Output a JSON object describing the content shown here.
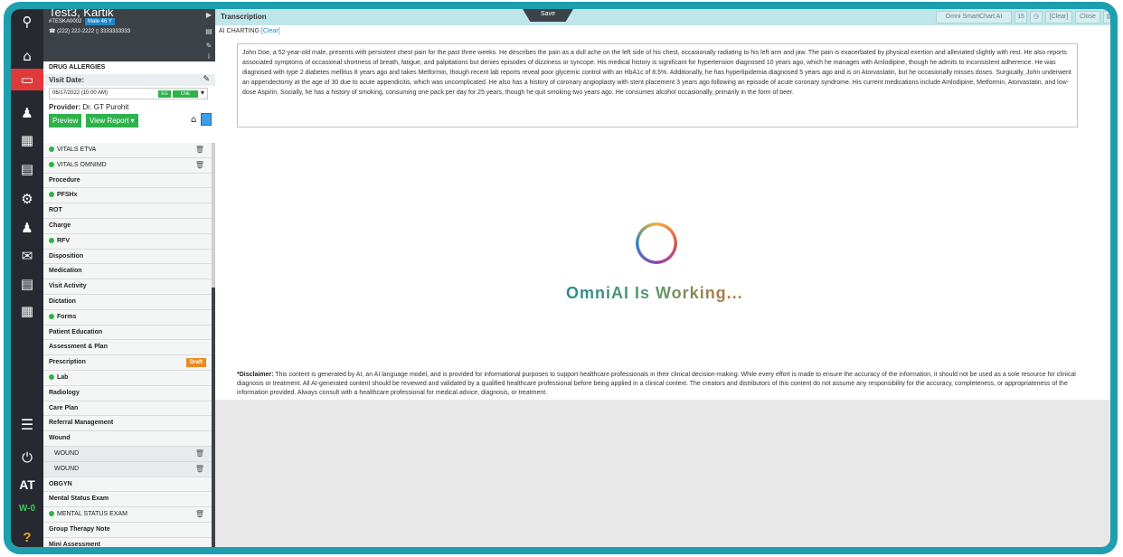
{
  "rail": {
    "items": [
      {
        "name": "search-icon",
        "glyph": "⚲"
      },
      {
        "name": "home-icon",
        "glyph": "⌂"
      },
      {
        "name": "chart-icon",
        "glyph": "▭",
        "active": true
      },
      {
        "name": "patient-icon",
        "glyph": "♟"
      },
      {
        "name": "calendar-icon",
        "glyph": "▦"
      },
      {
        "name": "billing-doc-icon",
        "glyph": "▤"
      },
      {
        "name": "dollar-gear-icon",
        "glyph": "⚙"
      },
      {
        "name": "patient-billing-icon",
        "glyph": "♟"
      },
      {
        "name": "messages-icon",
        "glyph": "✉"
      },
      {
        "name": "document-icon",
        "glyph": "▤"
      },
      {
        "name": "grid-icon",
        "glyph": "▦"
      }
    ],
    "bottom": {
      "menu": "☰",
      "power": "⏻",
      "initials": "AT",
      "workstation": "W-0",
      "help": "?"
    }
  },
  "patient": {
    "name": "Test3, Kartik",
    "id": "#TESKA0002",
    "badge": "Male 46 Y",
    "phone": "(222) 222-2222  ▯ 3333333333"
  },
  "visit": {
    "allergies": "DRUG ALLERGIES",
    "date_label": "Visit Date:",
    "date_value": "06/17/2022 (10:00 AM)",
    "tag1": "EG",
    "tag2": "CNE",
    "provider_label": "Provider:",
    "provider_name": "Dr. GT Purohit",
    "preview": "Preview",
    "view_report": "View Report ▾"
  },
  "menu": [
    {
      "label": "VITALS ETVA",
      "dot": true,
      "trash": true
    },
    {
      "label": "VITALS OMNIMD",
      "dot": true,
      "trash": true
    },
    {
      "label": "Procedure",
      "bold": true
    },
    {
      "label": "PFSHx",
      "dot": true,
      "bold": true
    },
    {
      "label": "ROT",
      "bold": true
    },
    {
      "label": "Charge",
      "bold": true
    },
    {
      "label": "RFV",
      "dot": true,
      "bold": true
    },
    {
      "label": "Disposition",
      "bold": true
    },
    {
      "label": "Medication",
      "bold": true
    },
    {
      "label": "Visit Activity",
      "bold": true
    },
    {
      "label": "Dictation",
      "bold": true
    },
    {
      "label": "Forms",
      "dot": true,
      "bold": true
    },
    {
      "label": "Patient Education",
      "bold": true
    },
    {
      "label": "Assessment & Plan",
      "bold": true
    },
    {
      "label": "Prescription",
      "bold": true,
      "draft": "Draft"
    },
    {
      "label": "Lab",
      "dot": true,
      "bold": true
    },
    {
      "label": "Radiology",
      "bold": true
    },
    {
      "label": "Care Plan",
      "bold": true
    },
    {
      "label": "Referral Management",
      "bold": true
    },
    {
      "label": "Wound",
      "bold": true
    },
    {
      "label": "WOUND",
      "sub": true,
      "trash": true
    },
    {
      "label": "WOUND",
      "sub": true,
      "trash": true
    },
    {
      "label": "OBGYN",
      "bold": true
    },
    {
      "label": "Mental Status Exam",
      "bold": true
    },
    {
      "label": "MENTAL STATUS EXAM",
      "dot": true,
      "trash": true
    },
    {
      "label": "Group Therapy Note",
      "bold": true
    },
    {
      "label": "Mini Assessment",
      "bold": true
    }
  ],
  "topbar": {
    "title": "Transcription",
    "save": "Save",
    "smartchart": "Omni SmartChart AI",
    "count": "15",
    "clock": "◷",
    "clear": "[Clear]",
    "close": "Close"
  },
  "content": {
    "ai_label": "AI CHARTING",
    "ai_clear": "[Clear]",
    "transcript": "John Doe, a 52-year-old male, presents with persistent chest pain for the past three weeks. He describes the pain as a dull ache on the left side of his chest, occasionally radiating to his left arm and jaw. The pain is exacerbated by physical exertion and alleviated slightly with rest. He also reports associated symptoms of occasional shortness of breath, fatigue, and palpitations but denies episodes of dizziness or syncope. His medical history is significant for hypertension diagnosed 10 years ago, which he manages with Amlodipine, though he admits to inconsistent adherence. He was diagnosed with type 2 diabetes mellitus 8 years ago and takes Metformin, though recent lab reports reveal poor glycemic control with an HbA1c of 8.5%. Additionally, he has hyperlipidemia diagnosed 5 years ago and is on Atorvastatin, but he occasionally misses doses. Surgically, John underwent an appendectomy at the age of 30 due to acute appendicitis, which was uncomplicated. He also has a history of coronary angioplasty with stent placement 3 years ago following an episode of acute coronary syndrome. His current medications include Amlodipine, Metformin, Atorvastatin, and low-dose Aspirin. Socially, he has a history of smoking, consuming one pack per day for 25 years, though he quit smoking two years ago. He consumes alcohol occasionally, primarily in the form of beer.",
    "working": "OmniAI Is Working...",
    "disclaimer_title": "*Disclaimer:",
    "disclaimer": "This content is generated by AI, an AI language model, and is provided for informational purposes to support healthcare professionals in their clinical decision-making. While every effort is made to ensure the accuracy of the information, it should not be used as a sole resource for clinical diagnosis or treatment. All AI-generated content should be reviewed and validated by a qualified healthcare professional before being applied in a clinical context. The creators and distributors of this content do not assume any responsibility for the accuracy, completeness, or appropriateness of the information provided. Always consult with a healthcare professional for medical advice, diagnosis, or treatment."
  }
}
